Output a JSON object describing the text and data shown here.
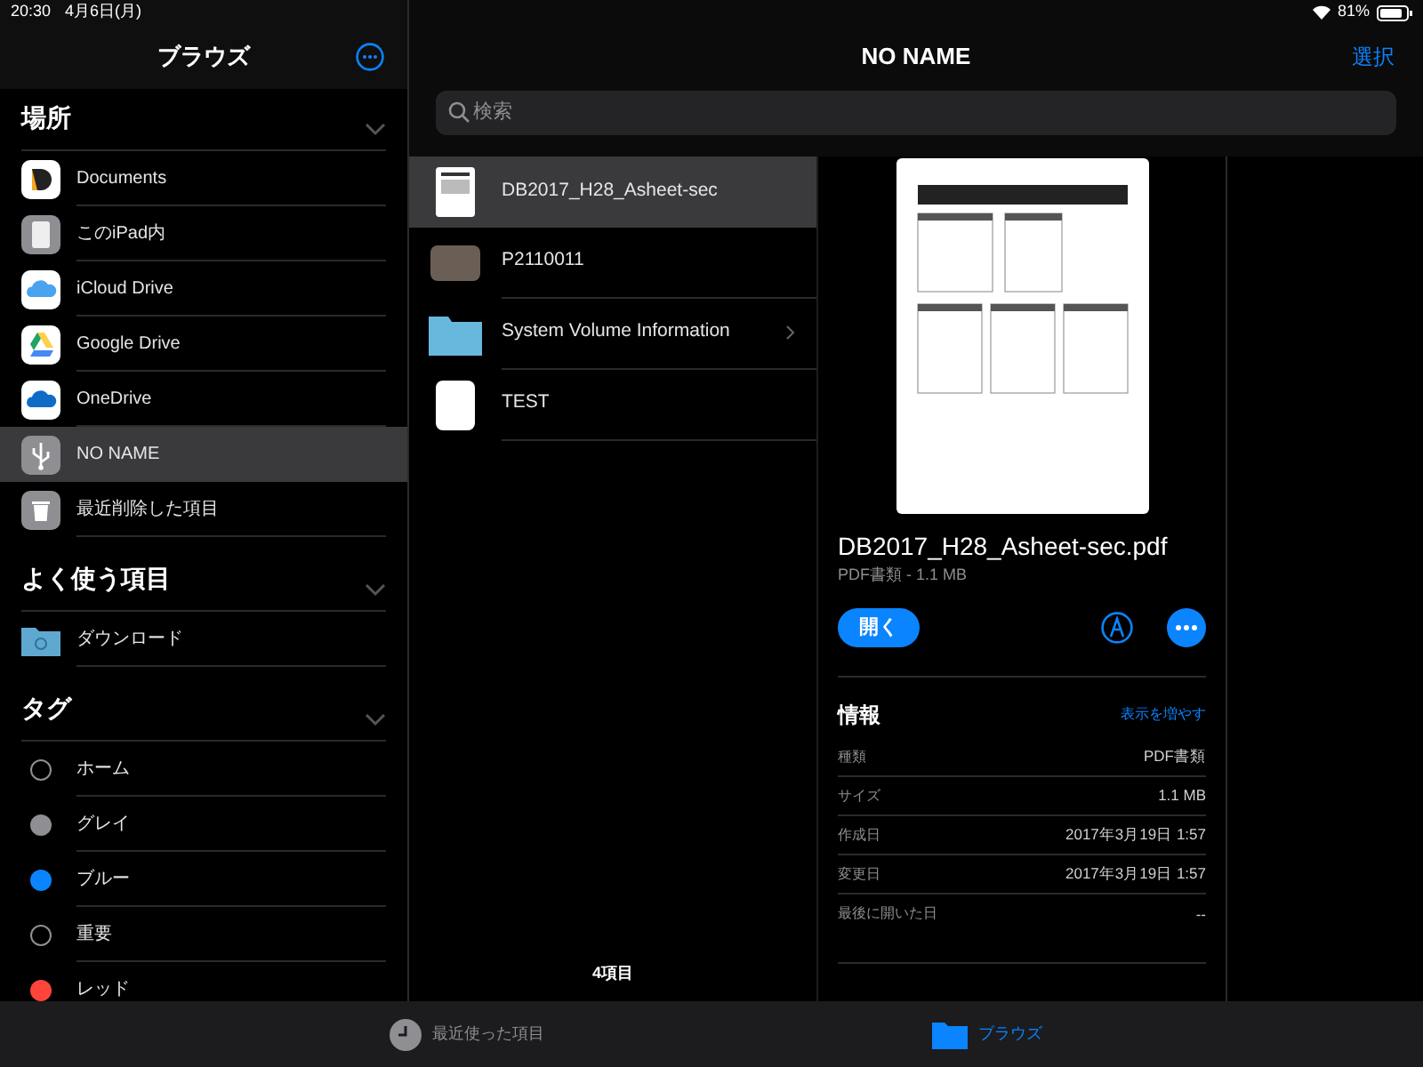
{
  "status_bar": {
    "time": "20:30",
    "date": "4月6日(月)",
    "battery": "81%"
  },
  "sidebar": {
    "title": "ブラウズ",
    "sections": [
      {
        "title": "場所",
        "expanded": true,
        "items": [
          {
            "label": "Documents",
            "kind": "documents",
            "selected": false
          },
          {
            "label": "このiPad内",
            "kind": "ipad",
            "selected": false
          },
          {
            "label": "iCloud Drive",
            "kind": "icloud",
            "selected": false
          },
          {
            "label": "Google Drive",
            "kind": "gdrive",
            "selected": false
          },
          {
            "label": "OneDrive",
            "kind": "onedrive",
            "selected": false
          },
          {
            "label": "NO NAME",
            "kind": "usb",
            "selected": true
          },
          {
            "label": "最近削除した項目",
            "kind": "trash",
            "selected": false
          }
        ]
      },
      {
        "title": "よく使う項目",
        "expanded": true,
        "items": [
          {
            "label": "ダウンロード",
            "kind": "download-folder",
            "selected": false
          }
        ]
      },
      {
        "title": "タグ",
        "expanded": true,
        "items": [
          {
            "label": "ホーム",
            "kind": "tag",
            "selected": false
          },
          {
            "label": "グレイ",
            "kind": "tag",
            "color": "#8e8e93",
            "selected": false
          },
          {
            "label": "ブルー",
            "kind": "tag",
            "color": "#0a84ff",
            "selected": false
          },
          {
            "label": "重要",
            "kind": "tag",
            "selected": false
          },
          {
            "label": "レッド",
            "kind": "tag",
            "color": "#ff453a",
            "selected": false
          }
        ]
      }
    ]
  },
  "main": {
    "title": "NO NAME",
    "select_button": "選択",
    "search": {
      "placeholder": "検索"
    }
  },
  "files": [
    {
      "name": "DB2017_H28_Asheet-sec",
      "kind": "pdf",
      "selected": true
    },
    {
      "name": "P2110011",
      "kind": "photo",
      "selected": false
    },
    {
      "name": "System Volume Information",
      "kind": "folder",
      "selected": false
    },
    {
      "name": "TEST",
      "kind": "blank",
      "selected": false
    }
  ],
  "item_count": "4項目",
  "detail": {
    "filename": "DB2017_H28_Asheet-sec.pdf",
    "subtitle": "PDF書類 - 1.1 MB",
    "open_button": "開く",
    "info_title": "情報",
    "more_link": "表示を増やす",
    "rows": [
      {
        "label": "種類",
        "value": "PDF書類"
      },
      {
        "label": "サイズ",
        "value": "1.1 MB"
      },
      {
        "label": "作成日",
        "value": "2017年3月19日 1:57"
      },
      {
        "label": "変更日",
        "value": "2017年3月19日 1:57"
      },
      {
        "label": "最後に開いた日",
        "value": "--"
      }
    ]
  },
  "tab_bar": [
    {
      "label": "最近使った項目",
      "kind": "recent",
      "selected": false
    },
    {
      "label": "ブラウズ",
      "kind": "browse",
      "selected": true
    }
  ]
}
